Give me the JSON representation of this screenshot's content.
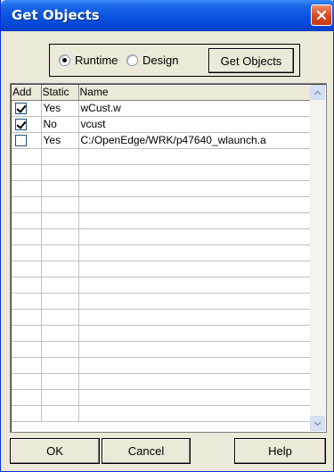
{
  "window": {
    "title": "Get Objects"
  },
  "mode": {
    "options": [
      {
        "label": "Runtime",
        "selected": true
      },
      {
        "label": "Design",
        "selected": false
      }
    ],
    "get_objects_label": "Get Objects"
  },
  "grid": {
    "columns": [
      "Add",
      "Static",
      "Name"
    ],
    "rows": [
      {
        "add": true,
        "static": "Yes",
        "name": "wCust.w"
      },
      {
        "add": true,
        "static": "No",
        "name": "vcust"
      },
      {
        "add": false,
        "static": "Yes",
        "name": "C:/OpenEdge/WRK/p47640_wlaunch.a"
      }
    ]
  },
  "footer": {
    "ok_label": "OK",
    "cancel_label": "Cancel",
    "help_label": "Help"
  },
  "colors": {
    "titlebar": "#0a54e0",
    "close": "#d9471f",
    "dialog_bg": "#ece9d8"
  }
}
